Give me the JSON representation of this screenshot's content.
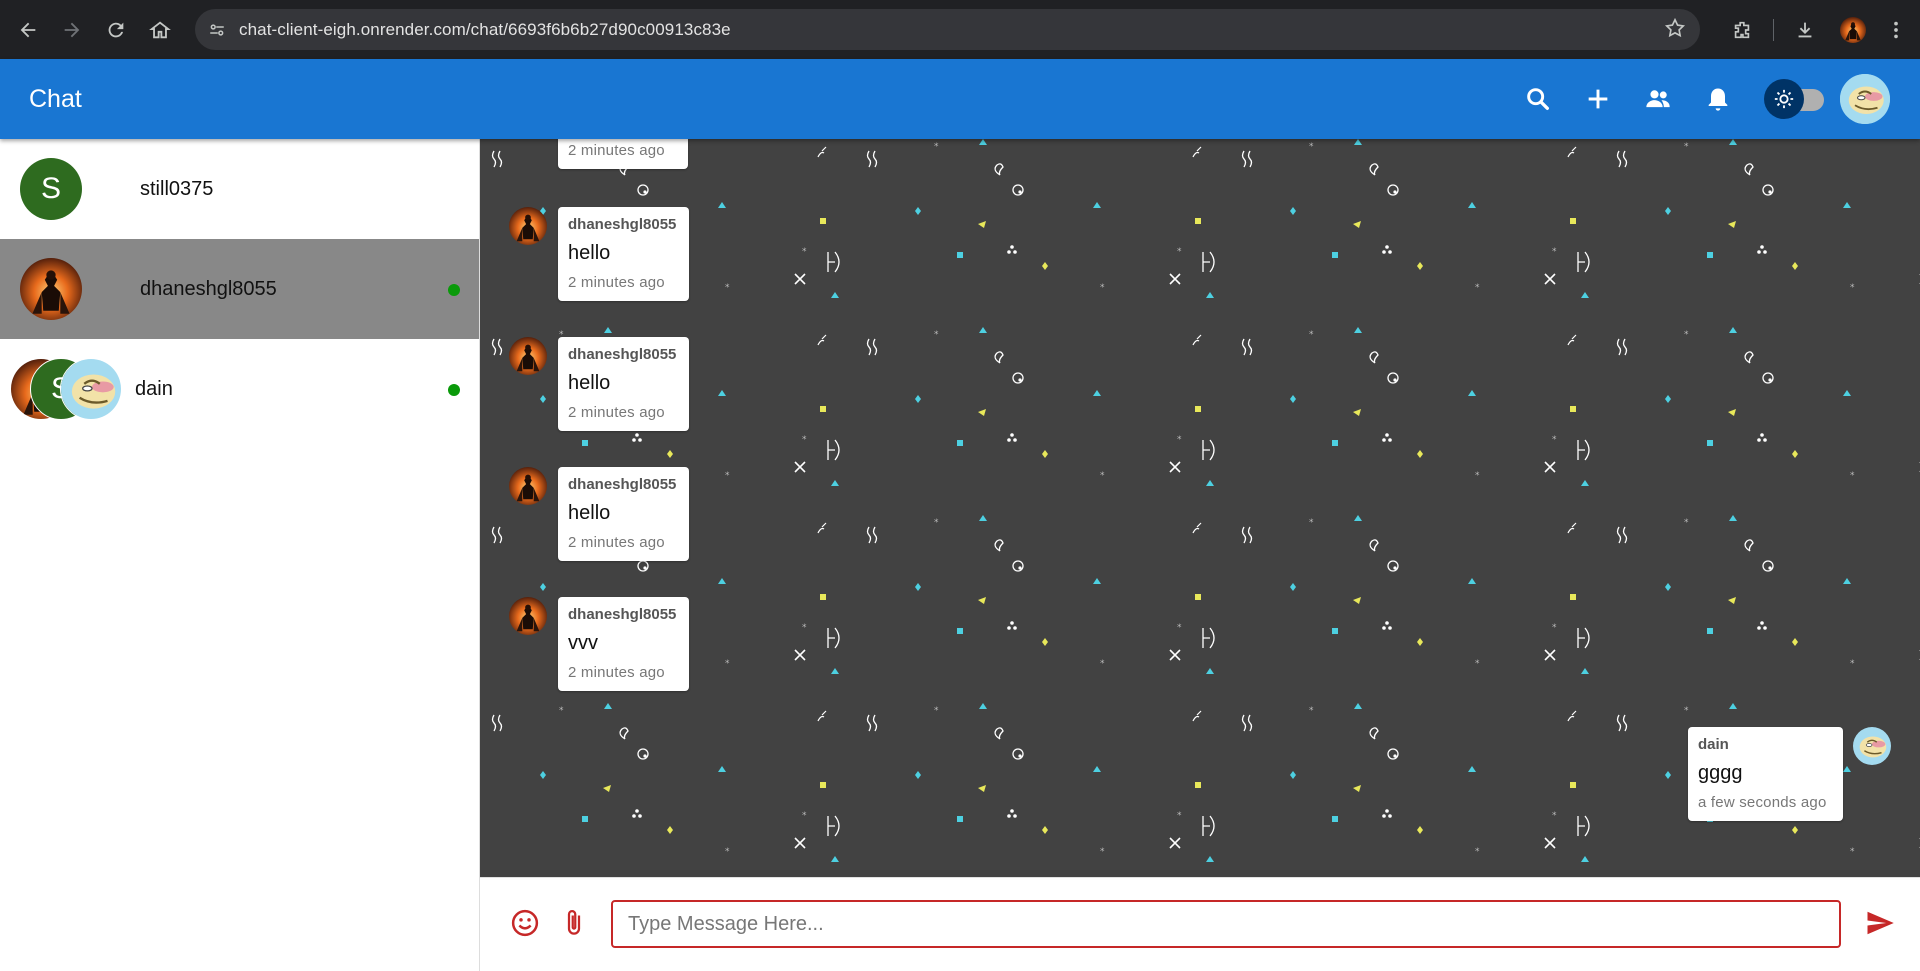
{
  "browser": {
    "url": "chat-client-eigh.onrender.com/chat/6693f6b6b27d90c00913c83e",
    "icons": [
      "back-icon",
      "forward-icon",
      "reload-icon",
      "home-icon",
      "site-info-icon",
      "bookmark-star-icon",
      "extensions-icon",
      "download-icon",
      "profile-avatar",
      "more-menu-icon"
    ]
  },
  "header": {
    "title": "Chat",
    "actions": [
      "search-icon",
      "add-icon",
      "group-icon",
      "bell-icon",
      "theme-toggle",
      "user-avatar"
    ],
    "colors": {
      "app_bar": "#1976d2"
    }
  },
  "sidebar": {
    "chats": [
      {
        "name": "still0375",
        "avatar_letter": "S",
        "online": false,
        "active": false
      },
      {
        "name": "dhaneshgl8055",
        "online": true,
        "active": true
      },
      {
        "name": "dain",
        "group_letter": "S",
        "online": true,
        "active": false
      }
    ]
  },
  "messages": [
    {
      "sender": "",
      "text": "",
      "time": "2 minutes ago",
      "side": "left"
    },
    {
      "sender": "dhaneshgl8055",
      "text": "hello",
      "time": "2 minutes ago",
      "side": "left"
    },
    {
      "sender": "dhaneshgl8055",
      "text": "hello",
      "time": "2 minutes ago",
      "side": "left"
    },
    {
      "sender": "dhaneshgl8055",
      "text": "hello",
      "time": "2 minutes ago",
      "side": "left"
    },
    {
      "sender": "dhaneshgl8055",
      "text": "vvv",
      "time": "2 minutes ago",
      "side": "left"
    },
    {
      "sender": "dain",
      "text": "gggg",
      "time": "a few seconds ago",
      "side": "right"
    }
  ],
  "composer": {
    "placeholder": "Type Message Here...",
    "icons": [
      "emoji-icon",
      "attach-icon",
      "send-icon"
    ],
    "accent": "#c62828"
  }
}
